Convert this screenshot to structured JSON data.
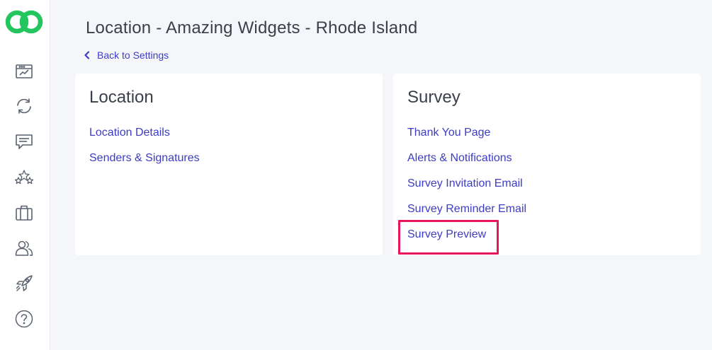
{
  "page": {
    "title": "Location - Amazing Widgets - Rhode Island",
    "back_label": "Back to Settings"
  },
  "sidebar": {
    "items": [
      {
        "icon": "dashboard-icon"
      },
      {
        "icon": "sync-icon"
      },
      {
        "icon": "chat-icon"
      },
      {
        "icon": "stars-icon"
      },
      {
        "icon": "briefcase-icon"
      },
      {
        "icon": "users-icon"
      },
      {
        "icon": "rocket-icon"
      },
      {
        "icon": "help-icon"
      }
    ]
  },
  "location_card": {
    "title": "Location",
    "links": [
      "Location Details",
      "Senders & Signatures"
    ]
  },
  "survey_card": {
    "title": "Survey",
    "links": [
      "Thank You Page",
      "Alerts & Notifications",
      "Survey Invitation Email",
      "Survey Reminder Email",
      "Survey Preview"
    ]
  },
  "colors": {
    "link": "#3c3cc4",
    "highlight": "#e8155c",
    "logo": "#22c55e"
  }
}
